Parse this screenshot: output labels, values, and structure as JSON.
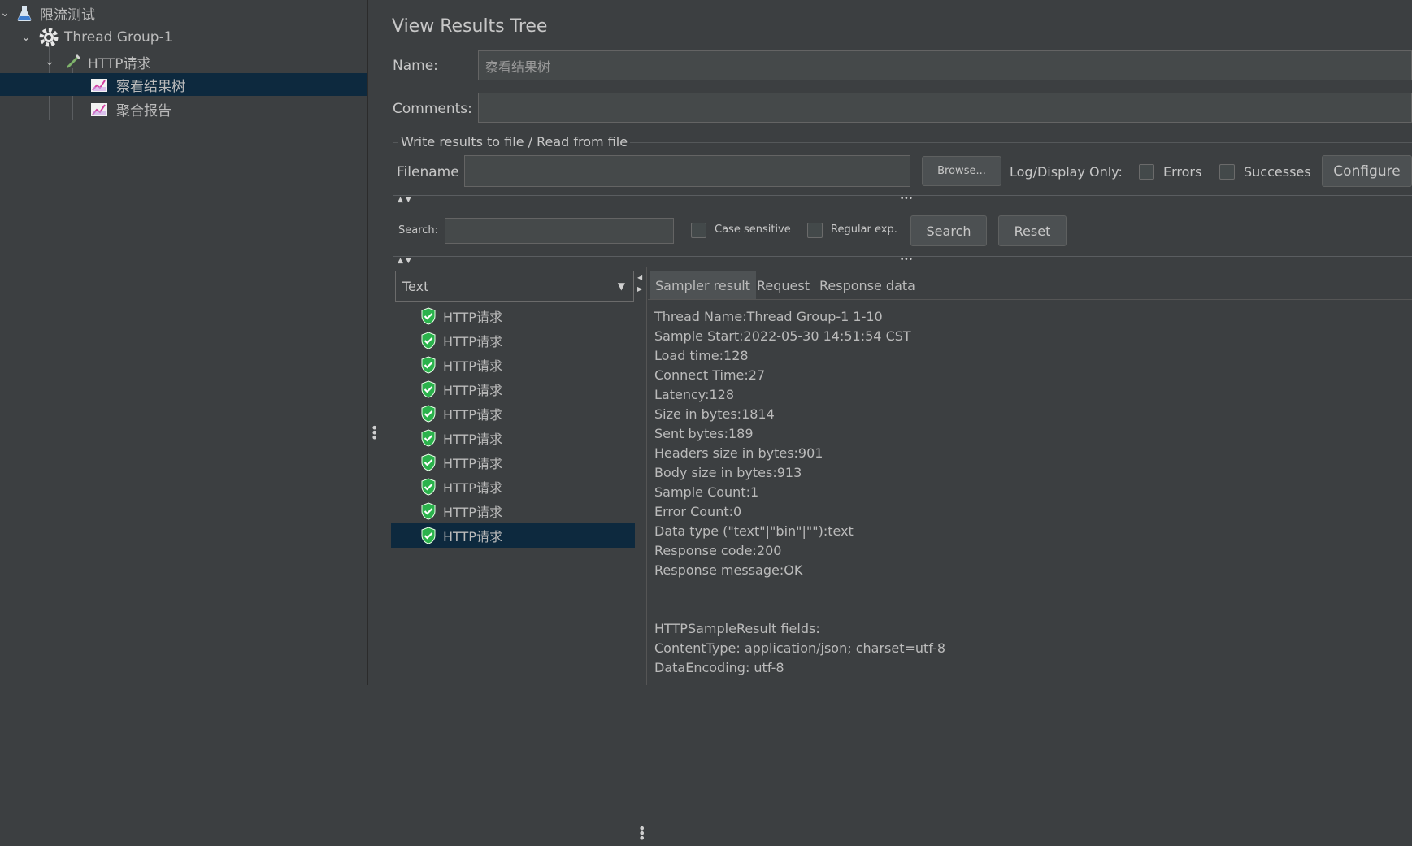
{
  "tree": {
    "items": [
      {
        "label": "限流测试",
        "icon": "flask-icon"
      },
      {
        "label": "Thread Group-1",
        "icon": "gear-icon"
      },
      {
        "label": "HTTP请求",
        "icon": "pipette-icon"
      },
      {
        "label": "察看结果树",
        "icon": "listener-chart-icon"
      },
      {
        "label": "聚合报告",
        "icon": "listener-chart-icon"
      }
    ]
  },
  "panel": {
    "title": "View Results Tree",
    "name_label": "Name:",
    "name_value": "察看结果树",
    "comments_label": "Comments:",
    "comments_value": "",
    "file_section_title": "Write results to file / Read from file",
    "filename_label": "Filename",
    "browse_label": "Browse...",
    "log_display_label": "Log/Display Only:",
    "errors_label": "Errors",
    "successes_label": "Successes",
    "configure_label": "Configure"
  },
  "search": {
    "label": "Search:",
    "value": "",
    "case_sensitive_label": "Case sensitive",
    "regex_label": "Regular exp.",
    "search_button": "Search",
    "reset_button": "Reset"
  },
  "renderer": {
    "selected": "Text"
  },
  "results": [
    "HTTP请求",
    "HTTP请求",
    "HTTP请求",
    "HTTP请求",
    "HTTP请求",
    "HTTP请求",
    "HTTP请求",
    "HTTP请求",
    "HTTP请求",
    "HTTP请求"
  ],
  "tabs": [
    "Sampler result",
    "Request",
    "Response data"
  ],
  "sampler_lines": [
    "Thread Name:Thread Group-1 1-10",
    "Sample Start:2022-05-30 14:51:54 CST",
    "Load time:128",
    "Connect Time:27",
    "Latency:128",
    "Size in bytes:1814",
    "Sent bytes:189",
    "Headers size in bytes:901",
    "Body size in bytes:913",
    "Sample Count:1",
    "Error Count:0",
    "Data type (\"text\"|\"bin\"|\"\"):text",
    "Response code:200",
    "Response message:OK"
  ],
  "http_fields_lines": [
    "HTTPSampleResult fields:",
    "ContentType: application/json; charset=utf-8",
    "DataEncoding: utf-8"
  ],
  "colors": {
    "background": "#3c3f41",
    "selection": "#0d293e",
    "success_green": "#2bb24c"
  }
}
